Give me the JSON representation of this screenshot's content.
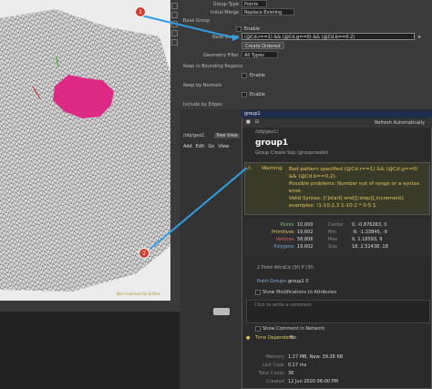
{
  "params": {
    "group_type_label": "Group Type",
    "group_type_value": "Points",
    "initial_merge_label": "Initial Merge",
    "initial_merge_value": "Replace Existing",
    "base_group_header": "Base Group",
    "enable_label": "Enable",
    "base_group_label": "Base Group",
    "base_group_value": "(@Cd.r==1) && (@Cd.g==0) && (@Cd.b==0.2)",
    "create_ordered_label": "Create Ordered",
    "geometry_filter_label": "Geometry Filter",
    "geometry_filter_value": "All Types",
    "keep_bounding_label": "Keep in Bounding Regions",
    "keep_normals_label": "Keep by Normals",
    "include_edges_label": "Include by Edges"
  },
  "network": {
    "path": "/obj/geo1",
    "tab_tree_view": "Tree View",
    "menu_add": "Add",
    "menu_edit": "Edit",
    "menu_go": "Go",
    "menu_view": "View"
  },
  "info": {
    "node_type": "group1",
    "refresh_label": "Refresh Automatically",
    "path": "/obj/geo1/",
    "node_name": "group1",
    "node_desc": "Group Create Sop (groupcreate)",
    "warning_label": "Warning",
    "warning_text": "Bad pattern specified (@Cd.r==1) && (@Cd.g==0) && (@Cd.b==0.2).",
    "warning_detail": "Possible problems: Number out of range or a syntax error.",
    "valid_syntax": "Valid Syntax: [!]start[-end][:step][,increment]",
    "examples": "examples: !1-10:2,3 1-10:2 * 0-5 1",
    "stats": [
      {
        "label": "Points",
        "value": "10,000"
      },
      {
        "label": "Primitives",
        "value": "19,602"
      },
      {
        "label": "Vertices",
        "value": "58,806"
      },
      {
        "label": "Polygons",
        "value": "19,602"
      }
    ],
    "bounds_headers": [
      "Center",
      "Min",
      "Max",
      "Size"
    ],
    "bounds": [
      {
        "label": "Center",
        "value": "0, -0.876263, 0"
      },
      {
        "label": "Min",
        "value": "-9, -1.33845, -9"
      },
      {
        "label": "Max",
        "value": "9, 1.18593, 9"
      },
      {
        "label": "Size",
        "value": "18, 2.52438, 18"
      }
    ],
    "point_attrs_label": "2 Point Attrs",
    "point_attrs": "Cd (3f)   P (3f)",
    "point_groups_label": "Point Groups:",
    "point_groups_value": "group1 0",
    "show_mod_label": "Show Modifications to Attributes",
    "comment_placeholder": "Click to write a comment",
    "show_comment_label": "Show Comment in Network",
    "time_dependent_label": "Time Dependent",
    "time_dependent_value": "No",
    "memory_label": "Memory",
    "memory_value": "1.27 MB, New: 39.28 KB",
    "last_cook_label": "Last Cook",
    "last_cook_value": "0.17 ms",
    "total_cooks_label": "Total Cooks",
    "total_cooks_value": "36",
    "created_label": "Created",
    "created_value": "12 Jun 2020 06:00 PM"
  },
  "viewport": {
    "status_text": "Non-Commercial Edition"
  },
  "annotations": {
    "badge1": "1",
    "badge2": "2",
    "arrow_color": "#2f9ee5"
  }
}
